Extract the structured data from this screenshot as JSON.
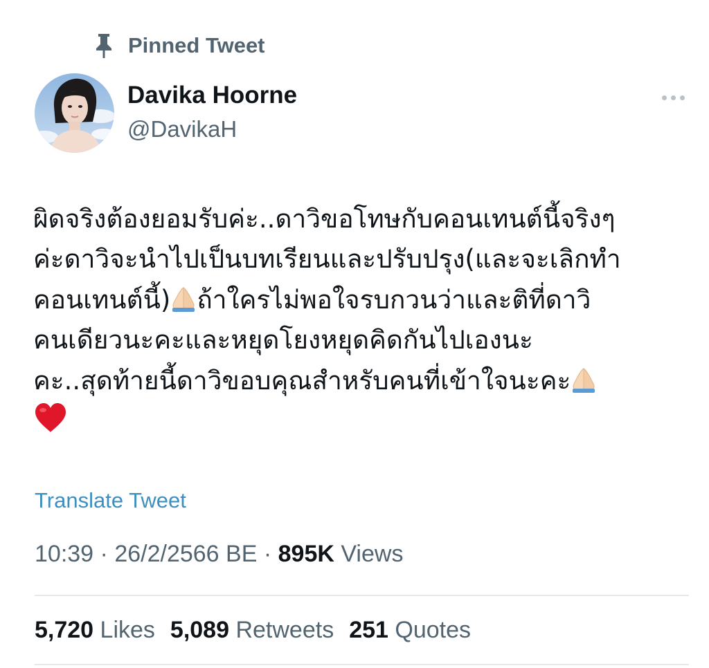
{
  "pinned": {
    "icon": "pin-icon",
    "label": "Pinned Tweet"
  },
  "author": {
    "avatar": "avatar-photo",
    "display_name": "Davika Hoorne",
    "handle": "@DavikaH"
  },
  "more": {
    "icon": "more-horizontal-icon"
  },
  "tweet": {
    "lines": [
      "ผิดจริงต้องยอมรับค่ะ..ดาวิขอโทษกับคอนเทนต์นี้จริงๆ",
      "ค่ะดาวิจะนำไปเป็นบทเรียนและปรับปรุง(และจะเลิกทำ",
      "คอนเทนต์นี้)",
      "ถ้าใครไม่พอใจรบกวนว่าและติที่ดาวิ",
      "คนเดียวนะคะและหยุดโยงหยุดคิดกันไปเองนะ",
      "คะ..สุดท้ายนี้ดาวิขอบคุณสำหรับคนที่เข้าใจนะคะ"
    ],
    "emojis": {
      "folded_hands": "folded-hands-emoji",
      "red_heart": "red-heart-emoji"
    }
  },
  "translate": {
    "label": "Translate Tweet"
  },
  "meta": {
    "time": "10:39",
    "date": "26/2/2566 BE",
    "separator": "·",
    "views_count": "895K",
    "views_label": "Views"
  },
  "stats": {
    "likes_count": "5,720",
    "likes_label": "Likes",
    "retweets_count": "5,089",
    "retweets_label": "Retweets",
    "quotes_count": "251",
    "quotes_label": "Quotes"
  },
  "colors": {
    "text_primary": "#0f1419",
    "text_secondary": "#536471",
    "link": "#3c8fc0",
    "divider": "#e4e8eb",
    "heart": "#e0162b"
  }
}
